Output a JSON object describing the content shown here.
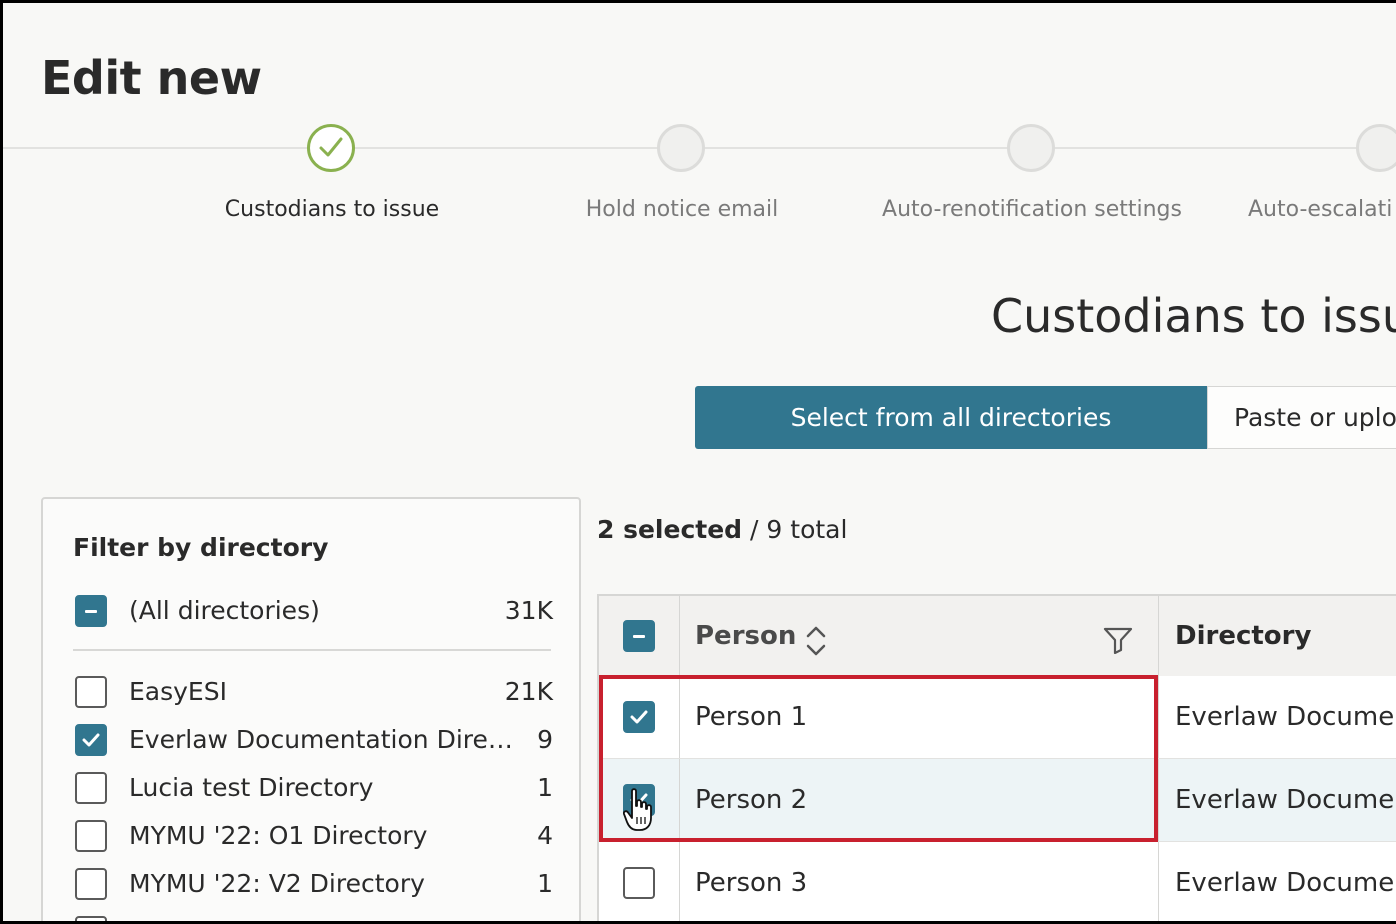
{
  "page": {
    "title": "Edit new"
  },
  "stepper": {
    "steps": [
      {
        "label": "Custodians to issue",
        "state": "completed"
      },
      {
        "label": "Hold notice email",
        "state": "pending"
      },
      {
        "label": "Auto-renotification settings",
        "state": "pending"
      },
      {
        "label": "Auto-escalati",
        "state": "pending"
      }
    ]
  },
  "section": {
    "title": "Custodians to issu"
  },
  "source_toggle": {
    "primary_label": "Select from all directories",
    "secondary_label": "Paste or uplo"
  },
  "filter": {
    "title": "Filter by directory",
    "all": {
      "label": "(All directories)",
      "count": "31K",
      "state": "partial"
    },
    "items": [
      {
        "label": "EasyESI",
        "count": "21K",
        "checked": false
      },
      {
        "label": "Everlaw Documentation Directory",
        "count": "9",
        "checked": true
      },
      {
        "label": "Lucia test Directory",
        "count": "1",
        "checked": false
      },
      {
        "label": "MYMU '22: O1 Directory",
        "count": "4",
        "checked": false
      },
      {
        "label": "MYMU '22: V2 Directory",
        "count": "1",
        "checked": false
      }
    ]
  },
  "selection": {
    "selected": "2 selected",
    "total": " / 9 total"
  },
  "table": {
    "columns": {
      "person": "Person",
      "directory": "Directory"
    },
    "header_checkbox_state": "partial",
    "rows": [
      {
        "person": "Person 1",
        "directory": "Everlaw Docume",
        "checked": true
      },
      {
        "person": "Person 2",
        "directory": "Everlaw Docume",
        "checked": true
      },
      {
        "person": "Person 3",
        "directory": "Everlaw Docume",
        "checked": false
      }
    ]
  },
  "colors": {
    "accent": "#31768f",
    "success": "#8ab14f",
    "highlight": "#c8202e",
    "row_hover": "#edf4f6"
  },
  "icons": {
    "completed_step": "checkmark-icon",
    "sort": "sort-icon",
    "filter": "funnel-icon",
    "cursor": "hand-pointer-icon"
  }
}
